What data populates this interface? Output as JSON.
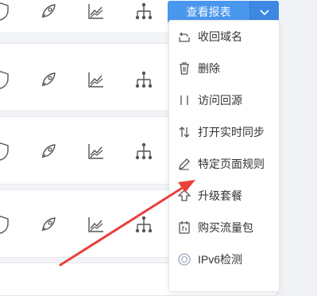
{
  "toolbar": {
    "view_report_label": "查看报表"
  },
  "menu": {
    "items": [
      {
        "label": "收回域名",
        "icon": "reclaim-domain-icon"
      },
      {
        "label": "删除",
        "icon": "trash-icon"
      },
      {
        "label": "访问回源",
        "icon": "origin-access-icon"
      },
      {
        "label": "打开实时同步",
        "icon": "sync-arrows-icon"
      },
      {
        "label": "特定页面规则",
        "icon": "pencil-icon"
      },
      {
        "label": "升级套餐",
        "icon": "upgrade-icon"
      },
      {
        "label": "购买流量包",
        "icon": "traffic-package-icon"
      },
      {
        "label": "IPv6检测",
        "icon": "ipv6-icon"
      }
    ]
  },
  "row_icons": [
    "shield-icon",
    "rocket-icon",
    "chart-icon",
    "topology-icon"
  ],
  "colors": {
    "primary": "#4a97ee",
    "primary_dark": "#3e88e4",
    "arrow": "#e8413c",
    "icon_gray": "#555555"
  }
}
